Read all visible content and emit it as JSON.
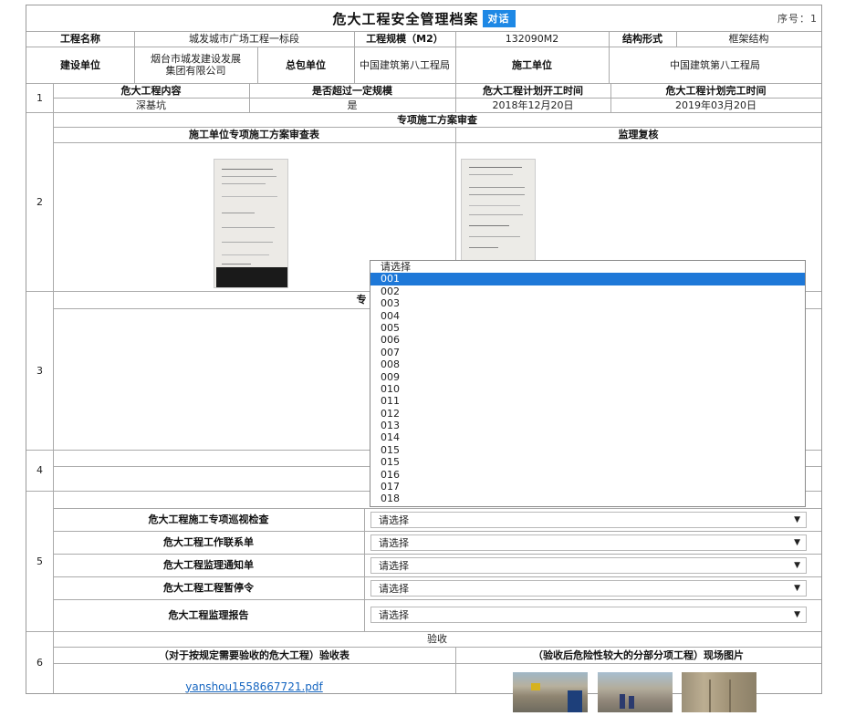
{
  "header": {
    "title": "危大工程安全管理档案",
    "dialog_btn": "对话",
    "seq": "序号：1"
  },
  "info": {
    "project_name_label": "工程名称",
    "project_name": "城发城市广场工程一标段",
    "scale_label": "工程规模（M2）",
    "scale": "132090M2",
    "structure_label": "结构形式",
    "structure": "框架结构",
    "builder_label": "建设单位",
    "builder": "烟台市城发建设发展集团有限公司",
    "general_label": "总包单位",
    "general": "中国建筑第八工程局",
    "construct_label": "施工单位",
    "construct": "中国建筑第八工程局"
  },
  "row1": {
    "num": "1",
    "h_content": "危大工程内容",
    "h_over": "是否超过一定规模",
    "h_start": "危大工程计划开工时间",
    "h_end": "危大工程计划完工时间",
    "content": "深基坑",
    "over": "是",
    "start": "2018年12月20日",
    "end": "2019年03月20日"
  },
  "row2": {
    "num": "2",
    "section": "专项施工方案审查",
    "left_header": "施工单位专项施工方案审查表",
    "right_header": "监理复核"
  },
  "row3": {
    "num": "3",
    "partial": "专"
  },
  "row4": {
    "num": "4"
  },
  "row5": {
    "num": "5",
    "items": [
      {
        "label": "危大工程施工专项巡视检查",
        "value": "请选择"
      },
      {
        "label": "危大工程工作联系单",
        "value": "请选择"
      },
      {
        "label": "危大工程监理通知单",
        "value": "请选择"
      },
      {
        "label": "危大工程工程暂停令",
        "value": "请选择"
      },
      {
        "label": "危大工程监理报告",
        "value": "请选择"
      }
    ]
  },
  "row6": {
    "num": "6",
    "section": "验收",
    "left_header": "（对于按规定需要验收的危大工程）验收表",
    "right_header": "（验收后危险性较大的分部分项工程）现场图片",
    "file_link": "yanshou1558667721.pdf"
  },
  "dropdown": {
    "options": [
      "请选择",
      "001",
      "002",
      "003",
      "004",
      "005",
      "006",
      "007",
      "008",
      "009",
      "010",
      "011",
      "012",
      "013",
      "014",
      "015",
      "015",
      "016",
      "017",
      "018"
    ],
    "selected_index": 1
  }
}
